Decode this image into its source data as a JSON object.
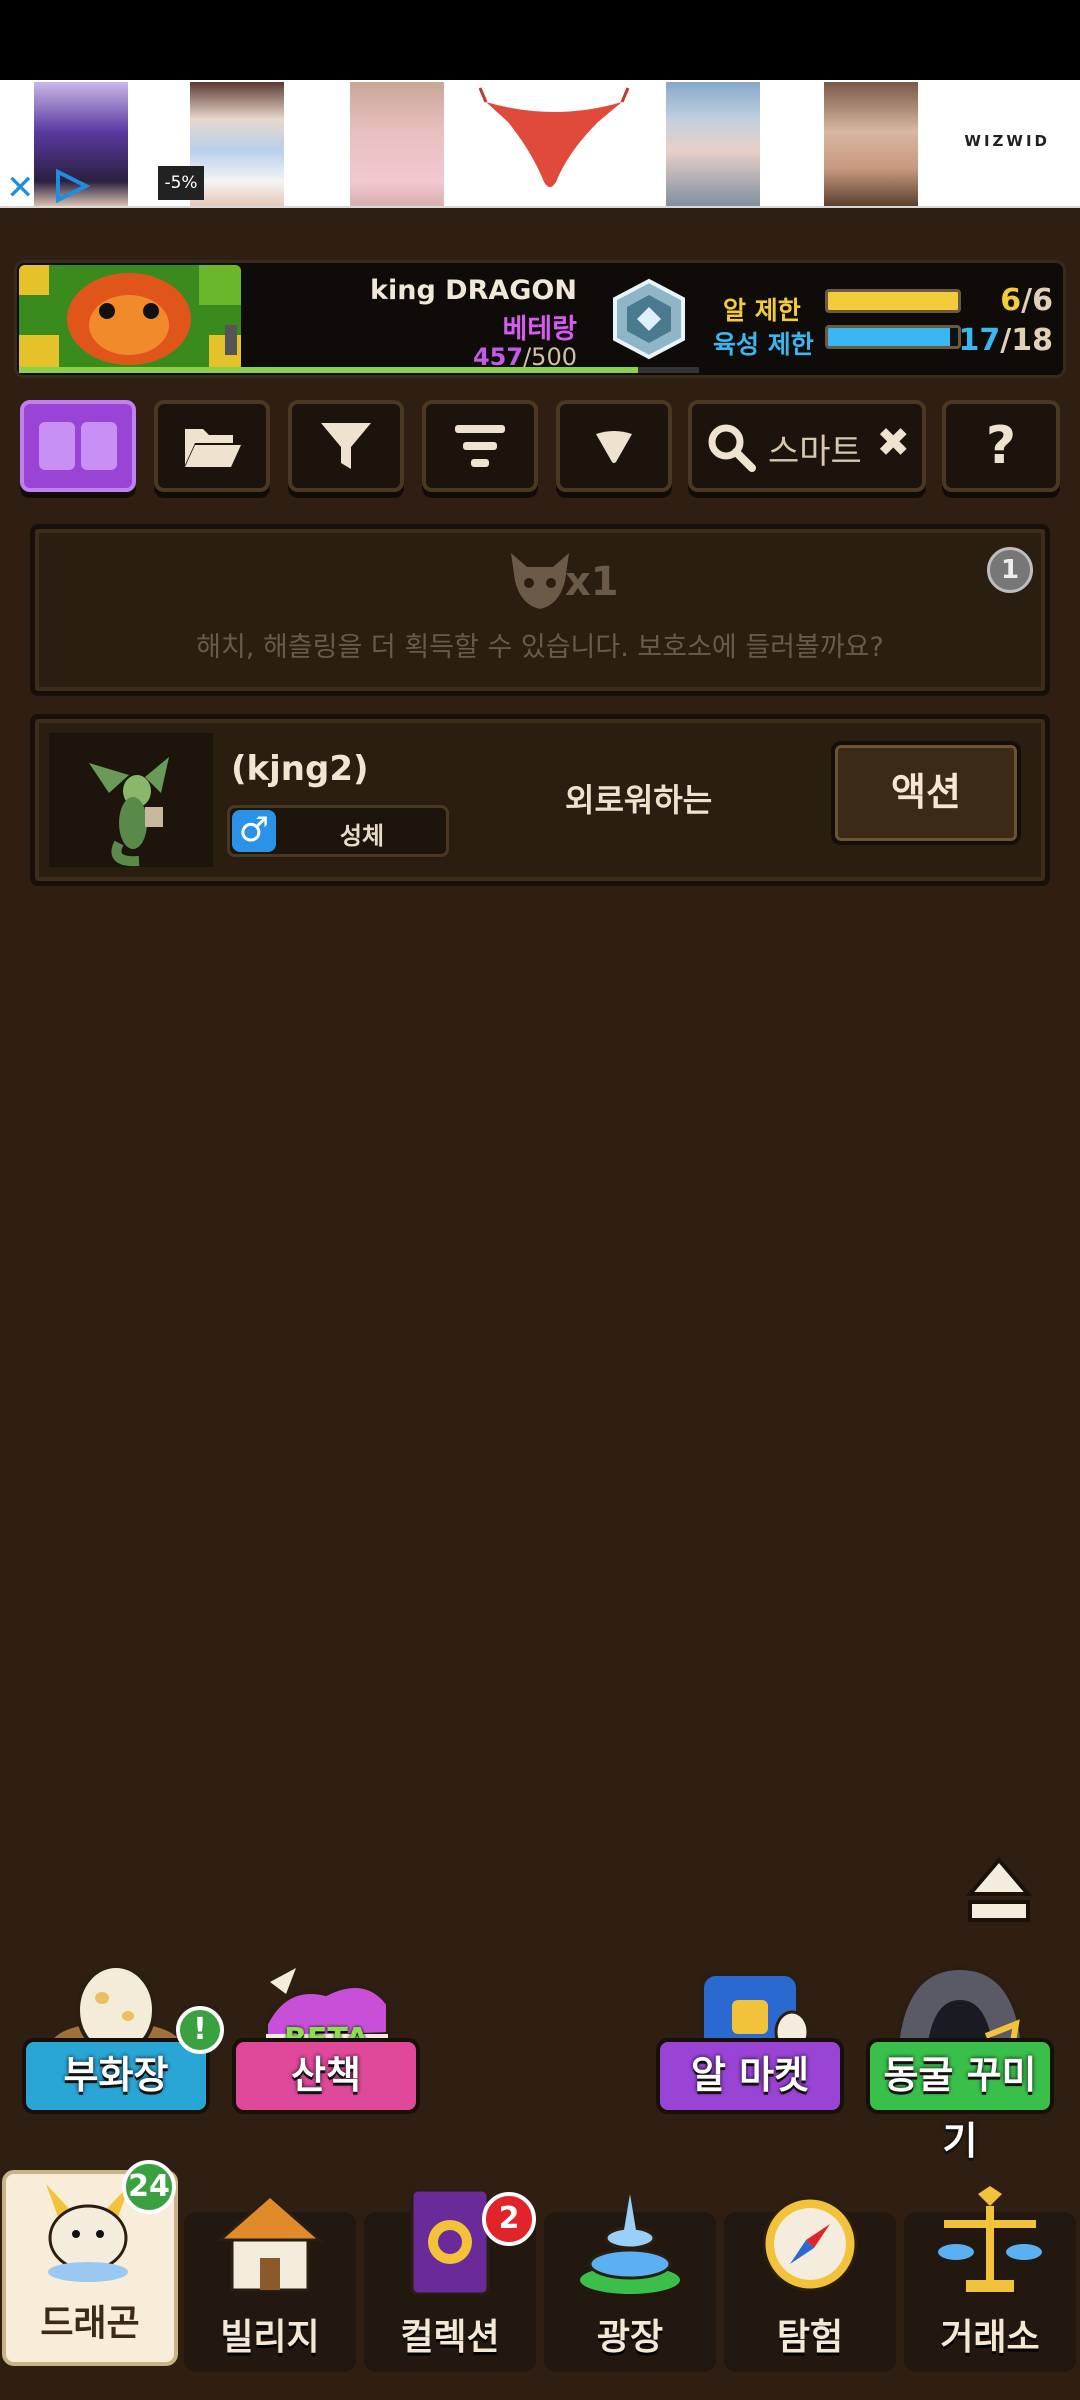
{
  "ad": {
    "discount": "-5%",
    "brand": "WIZWID"
  },
  "profile": {
    "name": "king DRAGON",
    "rank": "베테랑",
    "xp_current": "457",
    "xp_max": "/500",
    "egg_limit_label": "알 제한",
    "egg_count": "6",
    "egg_max": "/6",
    "grow_limit_label": "육성 제한",
    "grow_count": "17",
    "grow_max": "/18"
  },
  "toolbar": {
    "search_placeholder": "스마트",
    "help_label": "?"
  },
  "notice": {
    "count": "x1",
    "message": "해치, 해츨링을 더 획득할 수 있습니다. 보호소에 들러볼까요?",
    "badge": "1"
  },
  "dragons": [
    {
      "name": "(kjng2)",
      "gender_symbol": "♂",
      "stage": "성체",
      "mood": "외로워하는",
      "action_label": "액션"
    }
  ],
  "quick": {
    "incubator": "부화장",
    "walk": "산책",
    "walk_tag": "BETA",
    "alert": "!",
    "egg_market": "알 마켓",
    "cave_decor": "동굴 꾸미기"
  },
  "nav": {
    "dragon": "드래곤",
    "dragon_badge": "24",
    "village": "빌리지",
    "collection": "컬렉션",
    "collection_badge": "2",
    "plaza": "광장",
    "explore": "탐험",
    "exchange": "거래소"
  },
  "colors": {
    "egg_bar": "#f2cc3a",
    "grow_bar": "#3ab6f0",
    "accent_purple": "#9a44d6"
  }
}
